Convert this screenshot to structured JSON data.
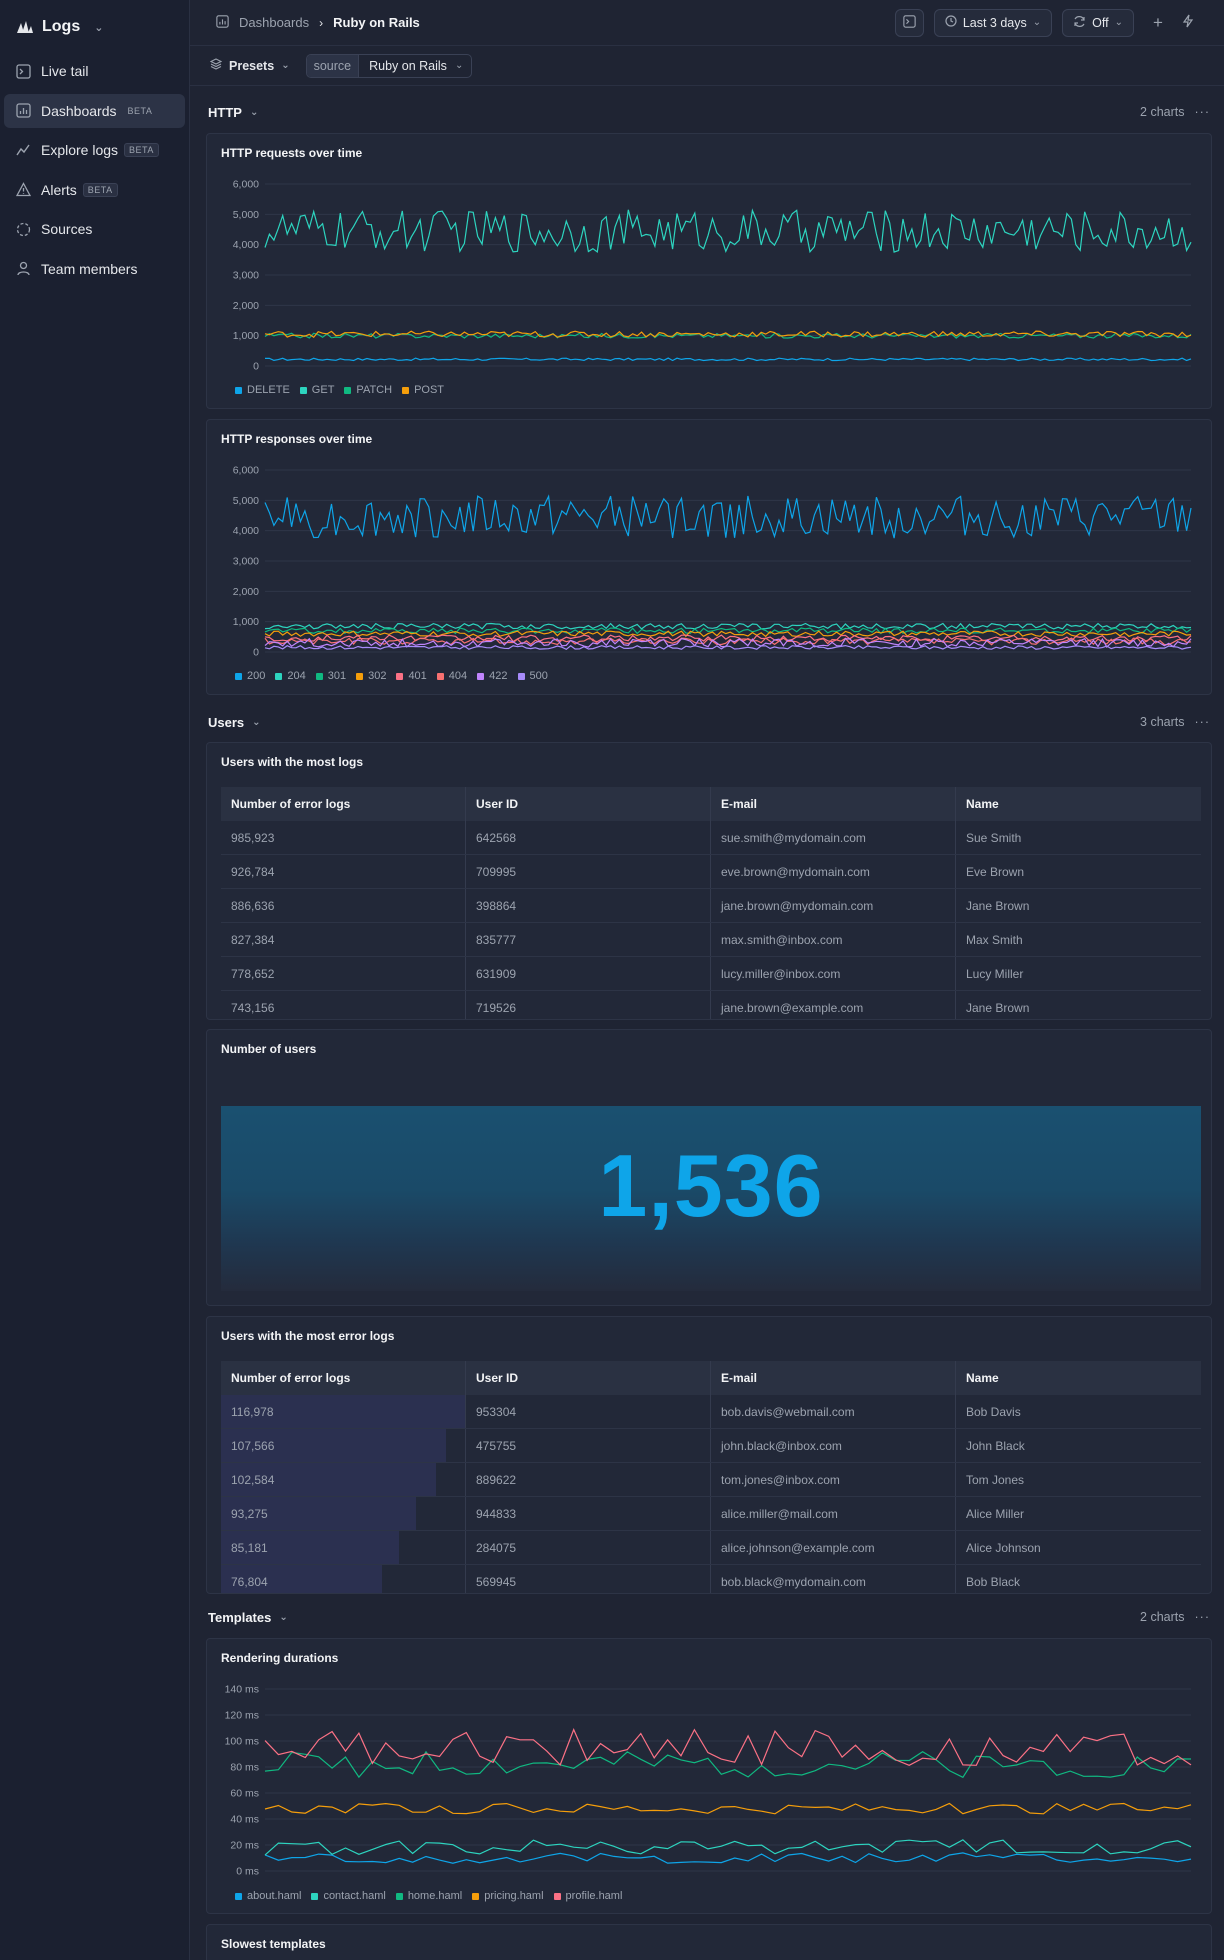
{
  "app": {
    "name": "Logs"
  },
  "sidebar": {
    "items": [
      {
        "label": "Live tail",
        "badge": ""
      },
      {
        "label": "Dashboards",
        "badge": "BETA"
      },
      {
        "label": "Explore logs",
        "badge": "BETA"
      },
      {
        "label": "Alerts",
        "badge": "BETA"
      },
      {
        "label": "Sources",
        "badge": ""
      },
      {
        "label": "Team members",
        "badge": ""
      }
    ]
  },
  "topbar": {
    "breadcrumb_root": "Dashboards",
    "breadcrumb_current": "Ruby on Rails",
    "time_range": "Last 3 days",
    "refresh": "Off"
  },
  "filters": {
    "presets_label": "Presets",
    "chip_key": "source",
    "chip_value": "Ruby on Rails"
  },
  "sections": {
    "http": {
      "title": "HTTP",
      "count": "2 charts"
    },
    "users": {
      "title": "Users",
      "count": "3 charts"
    },
    "templates": {
      "title": "Templates",
      "count": "2 charts"
    }
  },
  "panels": {
    "http_requests_title": "HTTP requests over time",
    "http_responses_title": "HTTP responses over time",
    "users_most_logs_title": "Users with the most logs",
    "number_of_users_title": "Number of users",
    "number_of_users_value": "1,536",
    "users_most_errors_title": "Users with the most error logs",
    "rendering_title": "Rendering durations",
    "slowest_title": "Slowest templates"
  },
  "tables": {
    "columns": [
      "Number of error logs",
      "User ID",
      "E-mail",
      "Name"
    ],
    "most_logs_rows": [
      [
        "985,923",
        "642568",
        "sue.smith@mydomain.com",
        "Sue Smith"
      ],
      [
        "926,784",
        "709995",
        "eve.brown@mydomain.com",
        "Eve Brown"
      ],
      [
        "886,636",
        "398864",
        "jane.brown@mydomain.com",
        "Jane Brown"
      ],
      [
        "827,384",
        "835777",
        "max.smith@inbox.com",
        "Max Smith"
      ],
      [
        "778,652",
        "631909",
        "lucy.miller@inbox.com",
        "Lucy Miller"
      ],
      [
        "743,156",
        "719526",
        "jane.brown@example.com",
        "Jane Brown"
      ]
    ],
    "most_errors_rows": [
      [
        "116,978",
        "953304",
        "bob.davis@webmail.com",
        "Bob Davis"
      ],
      [
        "107,566",
        "475755",
        "john.black@inbox.com",
        "John Black"
      ],
      [
        "102,584",
        "889622",
        "tom.jones@inbox.com",
        "Tom Jones"
      ],
      [
        "93,275",
        "944833",
        "alice.miller@mail.com",
        "Alice Miller"
      ],
      [
        "85,181",
        "284075",
        "alice.johnson@example.com",
        "Alice Johnson"
      ],
      [
        "76,804",
        "569945",
        "bob.black@mydomain.com",
        "Bob Black"
      ]
    ],
    "most_errors_values": [
      116978,
      107566,
      102584,
      93275,
      85181,
      76804
    ]
  },
  "colors": {
    "blue": "#0ea5e9",
    "teal": "#2dd4bf",
    "green": "#10b981",
    "orange": "#f59e0b",
    "red": "#f87171",
    "coral": "#fb7185",
    "purple": "#c084fc",
    "violet": "#a78bfa",
    "pink": "#f472b6"
  },
  "chart_data": [
    {
      "type": "line",
      "title": "HTTP requests over time",
      "ylim": [
        0,
        6000
      ],
      "yticks": [
        "0",
        "1,000",
        "2,000",
        "3,000",
        "4,000",
        "5,000",
        "6,000"
      ],
      "grid": true,
      "legend_position": "bottom-left",
      "series": [
        {
          "name": "DELETE",
          "color": "#0ea5e9",
          "mean": 220,
          "amp": 40
        },
        {
          "name": "GET",
          "color": "#2dd4bf",
          "mean": 4450,
          "amp": 700
        },
        {
          "name": "PATCH",
          "color": "#10b981",
          "mean": 1000,
          "amp": 80
        },
        {
          "name": "POST",
          "color": "#f59e0b",
          "mean": 1050,
          "amp": 100
        }
      ]
    },
    {
      "type": "line",
      "title": "HTTP responses over time",
      "ylim": [
        0,
        6000
      ],
      "yticks": [
        "0",
        "1,000",
        "2,000",
        "3,000",
        "4,000",
        "5,000",
        "6,000"
      ],
      "grid": true,
      "legend_position": "bottom-left",
      "series": [
        {
          "name": "200",
          "color": "#0ea5e9",
          "mean": 4450,
          "amp": 700
        },
        {
          "name": "204",
          "color": "#2dd4bf",
          "mean": 850,
          "amp": 90
        },
        {
          "name": "301",
          "color": "#10b981",
          "mean": 700,
          "amp": 90
        },
        {
          "name": "302",
          "color": "#f59e0b",
          "mean": 600,
          "amp": 90
        },
        {
          "name": "401",
          "color": "#fb7185",
          "mean": 450,
          "amp": 110
        },
        {
          "name": "404",
          "color": "#f87171",
          "mean": 350,
          "amp": 110
        },
        {
          "name": "422",
          "color": "#c084fc",
          "mean": 300,
          "amp": 140
        },
        {
          "name": "500",
          "color": "#a78bfa",
          "mean": 150,
          "amp": 60
        }
      ]
    },
    {
      "type": "line",
      "title": "Rendering durations",
      "ylim": [
        0,
        140
      ],
      "yticks": [
        "0 ms",
        "20 ms",
        "40 ms",
        "60 ms",
        "80 ms",
        "100 ms",
        "120 ms",
        "140 ms"
      ],
      "grid": true,
      "legend_position": "bottom-left",
      "series": [
        {
          "name": "about.haml",
          "color": "#0ea5e9",
          "mean": 10,
          "amp": 4
        },
        {
          "name": "contact.haml",
          "color": "#2dd4bf",
          "mean": 18,
          "amp": 6
        },
        {
          "name": "home.haml",
          "color": "#10b981",
          "mean": 82,
          "amp": 10
        },
        {
          "name": "pricing.haml",
          "color": "#f59e0b",
          "mean": 48,
          "amp": 4
        },
        {
          "name": "profile.haml",
          "color": "#fb7185",
          "mean": 95,
          "amp": 14
        }
      ]
    }
  ]
}
